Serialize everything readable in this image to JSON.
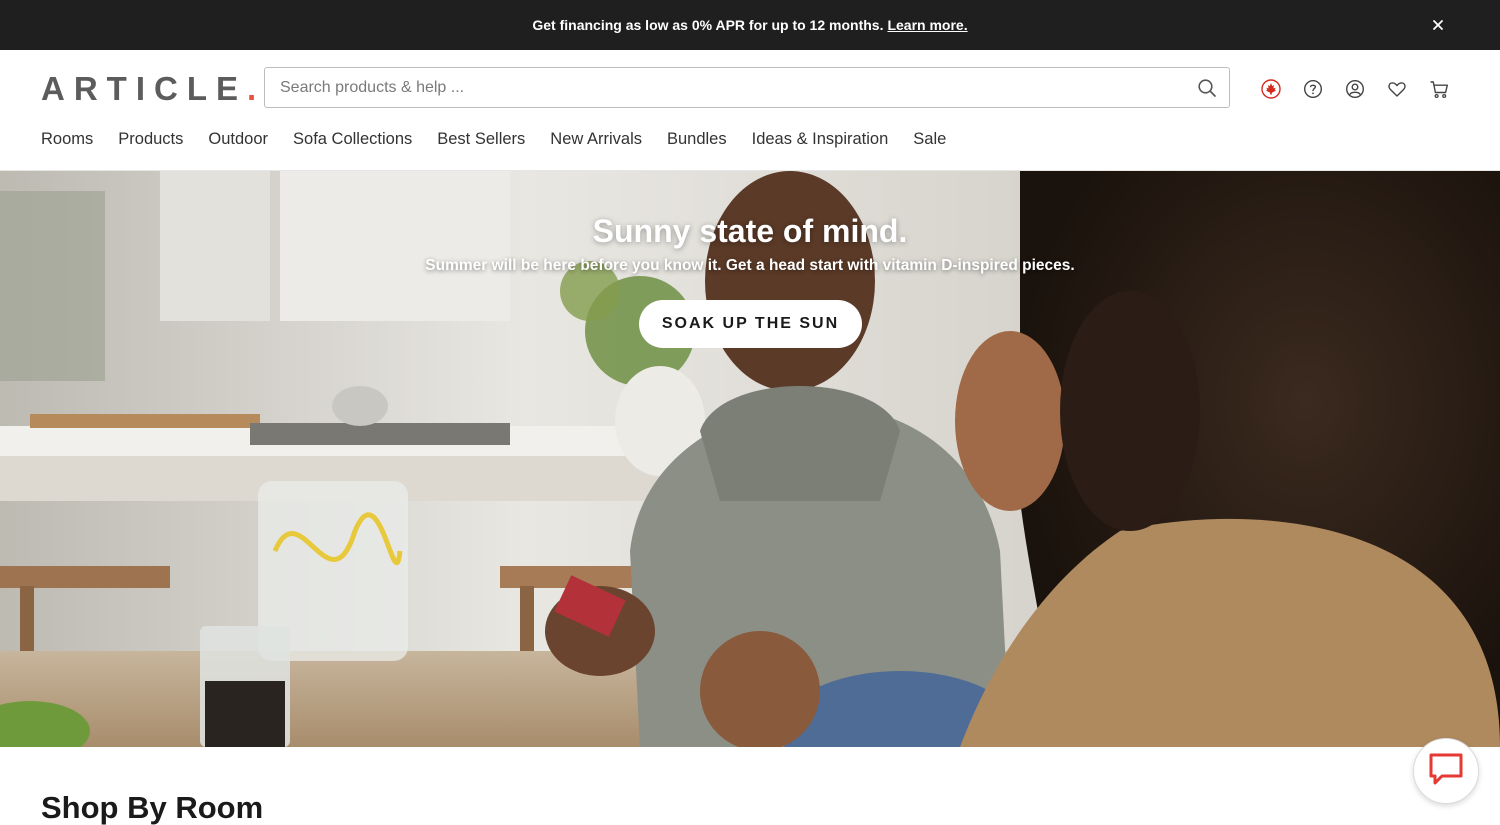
{
  "promo": {
    "text": "Get financing as low as 0% APR for up to 12 months.",
    "link_label": "Learn more.",
    "close_icon": "close-icon"
  },
  "header": {
    "logo_text": "ARTICLE",
    "logo_dot": ".",
    "search_placeholder": "Search products & help ...",
    "icons": [
      "search-icon",
      "canada-flag-icon",
      "help-icon",
      "account-icon",
      "heart-icon",
      "cart-icon"
    ]
  },
  "nav": {
    "items": [
      "Rooms",
      "Products",
      "Outdoor",
      "Sofa Collections",
      "Best Sellers",
      "New Arrivals",
      "Bundles",
      "Ideas & Inspiration",
      "Sale"
    ]
  },
  "hero": {
    "title": "Sunny state of mind.",
    "subtitle": "Summer will be here before you know it. Get a head start with vitamin D-inspired pieces.",
    "cta_label": "SOAK UP THE SUN"
  },
  "section": {
    "title": "Shop By Room"
  },
  "chat": {
    "icon": "chat-icon"
  },
  "colors": {
    "promo_bg": "#1f1f1f",
    "logo_dot": "#e8523f",
    "flag_red": "#d52b1e",
    "chat_red": "#e53935"
  }
}
